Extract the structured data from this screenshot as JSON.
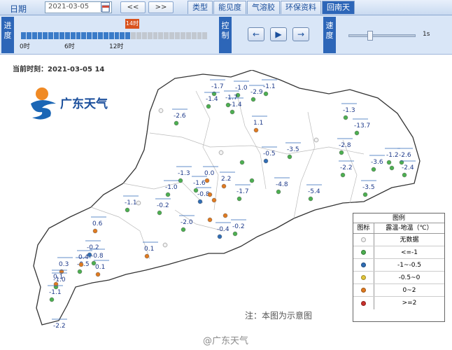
{
  "toolbar": {
    "date_label": "日期",
    "date_value": "2021-03-05",
    "prev_label": "<<",
    "next_label": ">>",
    "tabs": [
      "类型",
      "能见度",
      "气溶胶",
      "环保资料",
      "回南天"
    ],
    "active_tab": "回南天"
  },
  "controls": {
    "progress_label": "进度",
    "control_label": "控制",
    "speed_label": "速度",
    "tick_labels": [
      "0时",
      "6时",
      "12时"
    ],
    "current_hour": "14时",
    "progress_fraction": 0.58,
    "play_buttons": {
      "back": "◀",
      "play": "▶",
      "forward": "▶"
    },
    "speed_value_label": "1s",
    "speed_fraction": 0.3
  },
  "map": {
    "current_time_label": "当前时刻：2021-03-05 14",
    "logo_text": "广东天气",
    "note": "注：本图为示意图",
    "watermark": "@广东天气",
    "colors": {
      "none": "#f2f2f2",
      "le_-1": "#4caf50",
      "-1_-0.5": "#2f6db5",
      "-0.5_0": "#e2c53a",
      "0_2": "#e07a1f",
      "ge_2": "#c9302c"
    },
    "stations": [
      {
        "v": "-1.7",
        "c": "le_-1"
      },
      {
        "v": "-1.0",
        "c": "le_-1"
      },
      {
        "v": "-2.9",
        "c": "le_-1"
      },
      {
        "v": "-1.1",
        "c": "le_-1"
      },
      {
        "v": "-1.4",
        "c": "le_-1"
      },
      {
        "v": "-1.7",
        "c": "le_-1"
      },
      {
        "v": "-1.4",
        "c": "le_-1"
      },
      {
        "v": "-2.6",
        "c": "le_-1"
      },
      {
        "v": "1.1",
        "c": "0_2"
      },
      {
        "v": "-0.5",
        "c": "-1_-0.5"
      },
      {
        "v": "-3.5",
        "c": "le_-1"
      },
      {
        "v": "-1.3",
        "c": "le_-1"
      },
      {
        "v": "-2.8",
        "c": "le_-1"
      },
      {
        "v": "-13.7",
        "c": "le_-1"
      },
      {
        "v": "-1.2",
        "c": "le_-1"
      },
      {
        "v": "-2.6",
        "c": "le_-1"
      },
      {
        "v": "-1.3",
        "c": "le_-1"
      },
      {
        "v": "0.0",
        "c": "0_2"
      },
      {
        "v": "2.2",
        "c": "0_2"
      },
      {
        "v": "-2.2",
        "c": "le_-1"
      },
      {
        "v": "-3.6",
        "c": "le_-1"
      },
      {
        "v": "-2.4",
        "c": "le_-1"
      },
      {
        "v": "-1.0",
        "c": "le_-1"
      },
      {
        "v": "-1.6",
        "c": "le_-1"
      },
      {
        "v": "-0.8",
        "c": "-1_-0.5"
      },
      {
        "v": "-1.7",
        "c": "le_-1"
      },
      {
        "v": "-4.8",
        "c": "le_-1"
      },
      {
        "v": "-5.4",
        "c": "le_-1"
      },
      {
        "v": "-3.5",
        "c": "le_-1"
      },
      {
        "v": "-1.1",
        "c": "le_-1"
      },
      {
        "v": "-0.2",
        "c": "le_-1"
      },
      {
        "v": "0.1",
        "c": "0_2"
      },
      {
        "v": "0.6",
        "c": "0_2"
      },
      {
        "v": "-2.0",
        "c": "le_-1"
      },
      {
        "v": "-0.4",
        "c": "-1_-0.5"
      },
      {
        "v": "-0.2",
        "c": "le_-1"
      },
      {
        "v": "-0.2",
        "c": "-1_-0.5"
      },
      {
        "v": "-0.8",
        "c": "le_-1"
      },
      {
        "v": "0.1",
        "c": "0_2"
      },
      {
        "v": "-0.5",
        "c": "le_-1"
      },
      {
        "v": "0.3",
        "c": "0_2"
      },
      {
        "v": "0.4",
        "c": "0_2"
      },
      {
        "v": "-1.0",
        "c": "le_-1"
      },
      {
        "v": "0.1",
        "c": "0_2"
      },
      {
        "v": "-1.1",
        "c": "le_-1"
      },
      {
        "v": "-2.2",
        "c": "le_-1"
      }
    ],
    "unlabeled_station_colors": [
      "0_2",
      "0_2",
      "0_2",
      "none",
      "none",
      "none",
      "le_-1",
      "le_-1",
      "none",
      "0_2",
      "none",
      "le_-1"
    ]
  },
  "legend": {
    "title": "图例",
    "col_icon": "图标",
    "col_value": "露温-地温（℃）",
    "rows": [
      {
        "label": "无数据",
        "c": "none"
      },
      {
        "label": "<=-1",
        "c": "le_-1"
      },
      {
        "label": "-1~-0.5",
        "c": "-1_-0.5"
      },
      {
        "label": "-0.5~0",
        "c": "-0.5_0"
      },
      {
        "label": "0~2",
        "c": "0_2"
      },
      {
        "label": ">=2",
        "c": "ge_2"
      }
    ]
  }
}
